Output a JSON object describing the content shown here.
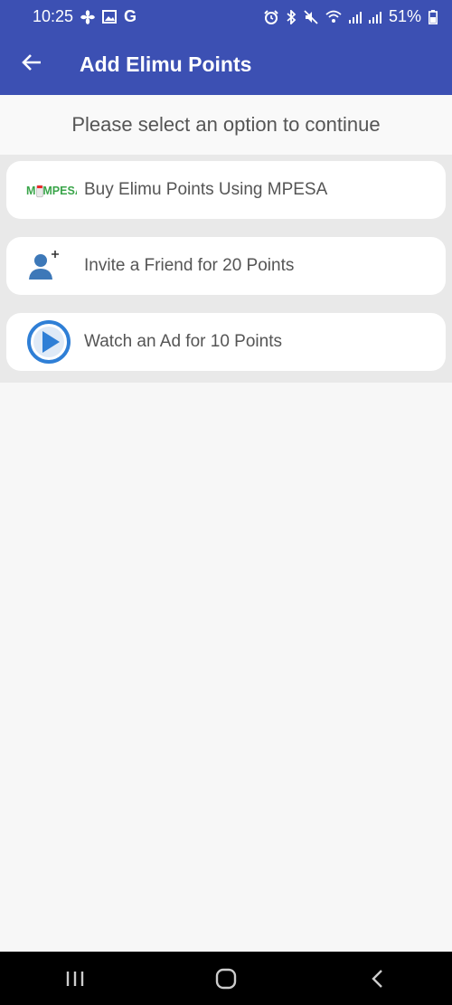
{
  "status_bar": {
    "time": "10:25",
    "left_icons": [
      "fan-icon",
      "image-icon",
      "google-icon"
    ],
    "right_icons": [
      "alarm-icon",
      "bluetooth-icon",
      "mute-icon",
      "wifi-icon",
      "signal-icon",
      "signal-icon"
    ],
    "battery": "51%",
    "g_label": "G"
  },
  "app_bar": {
    "title": "Add Elimu Points",
    "back_icon": "arrow-back-icon"
  },
  "main": {
    "prompt": "Please select an option to continue",
    "options": [
      {
        "label": "Buy Elimu Points Using MPESA",
        "icon": "mpesa-logo",
        "logo_text": "MPESA"
      },
      {
        "label": "Invite a Friend for 20 Points",
        "icon": "add-person-icon"
      },
      {
        "label": "Watch an Ad for 10 Points",
        "icon": "play-circle-icon"
      }
    ]
  },
  "colors": {
    "primary": "#3c50b3",
    "mpesa_green": "#3aa54a",
    "play_blue": "#2f7fd6"
  }
}
